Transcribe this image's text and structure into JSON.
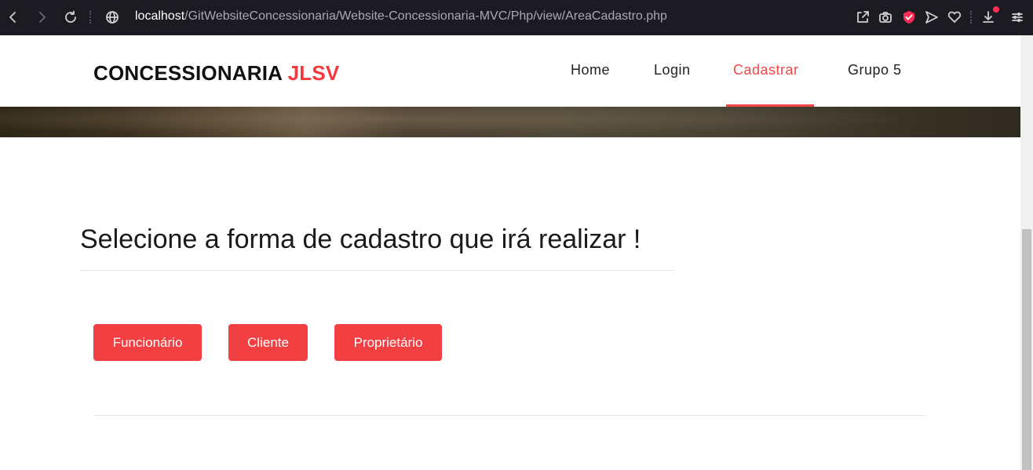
{
  "browser": {
    "url_host": "localhost",
    "url_path": "/GitWebsiteConcessionaria/Website-Concessionaria-MVC/Php/view/AreaCadastro.php",
    "icons": [
      "back-icon",
      "forward-icon",
      "reload-icon",
      "site-info-icon",
      "share-icon",
      "camera-icon",
      "shield-icon",
      "send-icon",
      "heart-icon",
      "download-icon",
      "menu-icon"
    ]
  },
  "header": {
    "brand_main": "CONCESSIONARIA",
    "brand_accent": "JLSV",
    "nav": [
      {
        "label": "Home"
      },
      {
        "label": "Login"
      },
      {
        "label": "Cadastrar",
        "active": true
      },
      {
        "label": "Grupo 5"
      }
    ]
  },
  "main": {
    "title": "Selecione a forma de cadastro que irá realizar !",
    "buttons": [
      {
        "label": "Funcionário"
      },
      {
        "label": "Cliente"
      },
      {
        "label": "Proprietário"
      }
    ]
  },
  "colors": {
    "accent": "#f23f42",
    "chrome_bg": "#1c1b22",
    "text": "#1a1a1a"
  }
}
